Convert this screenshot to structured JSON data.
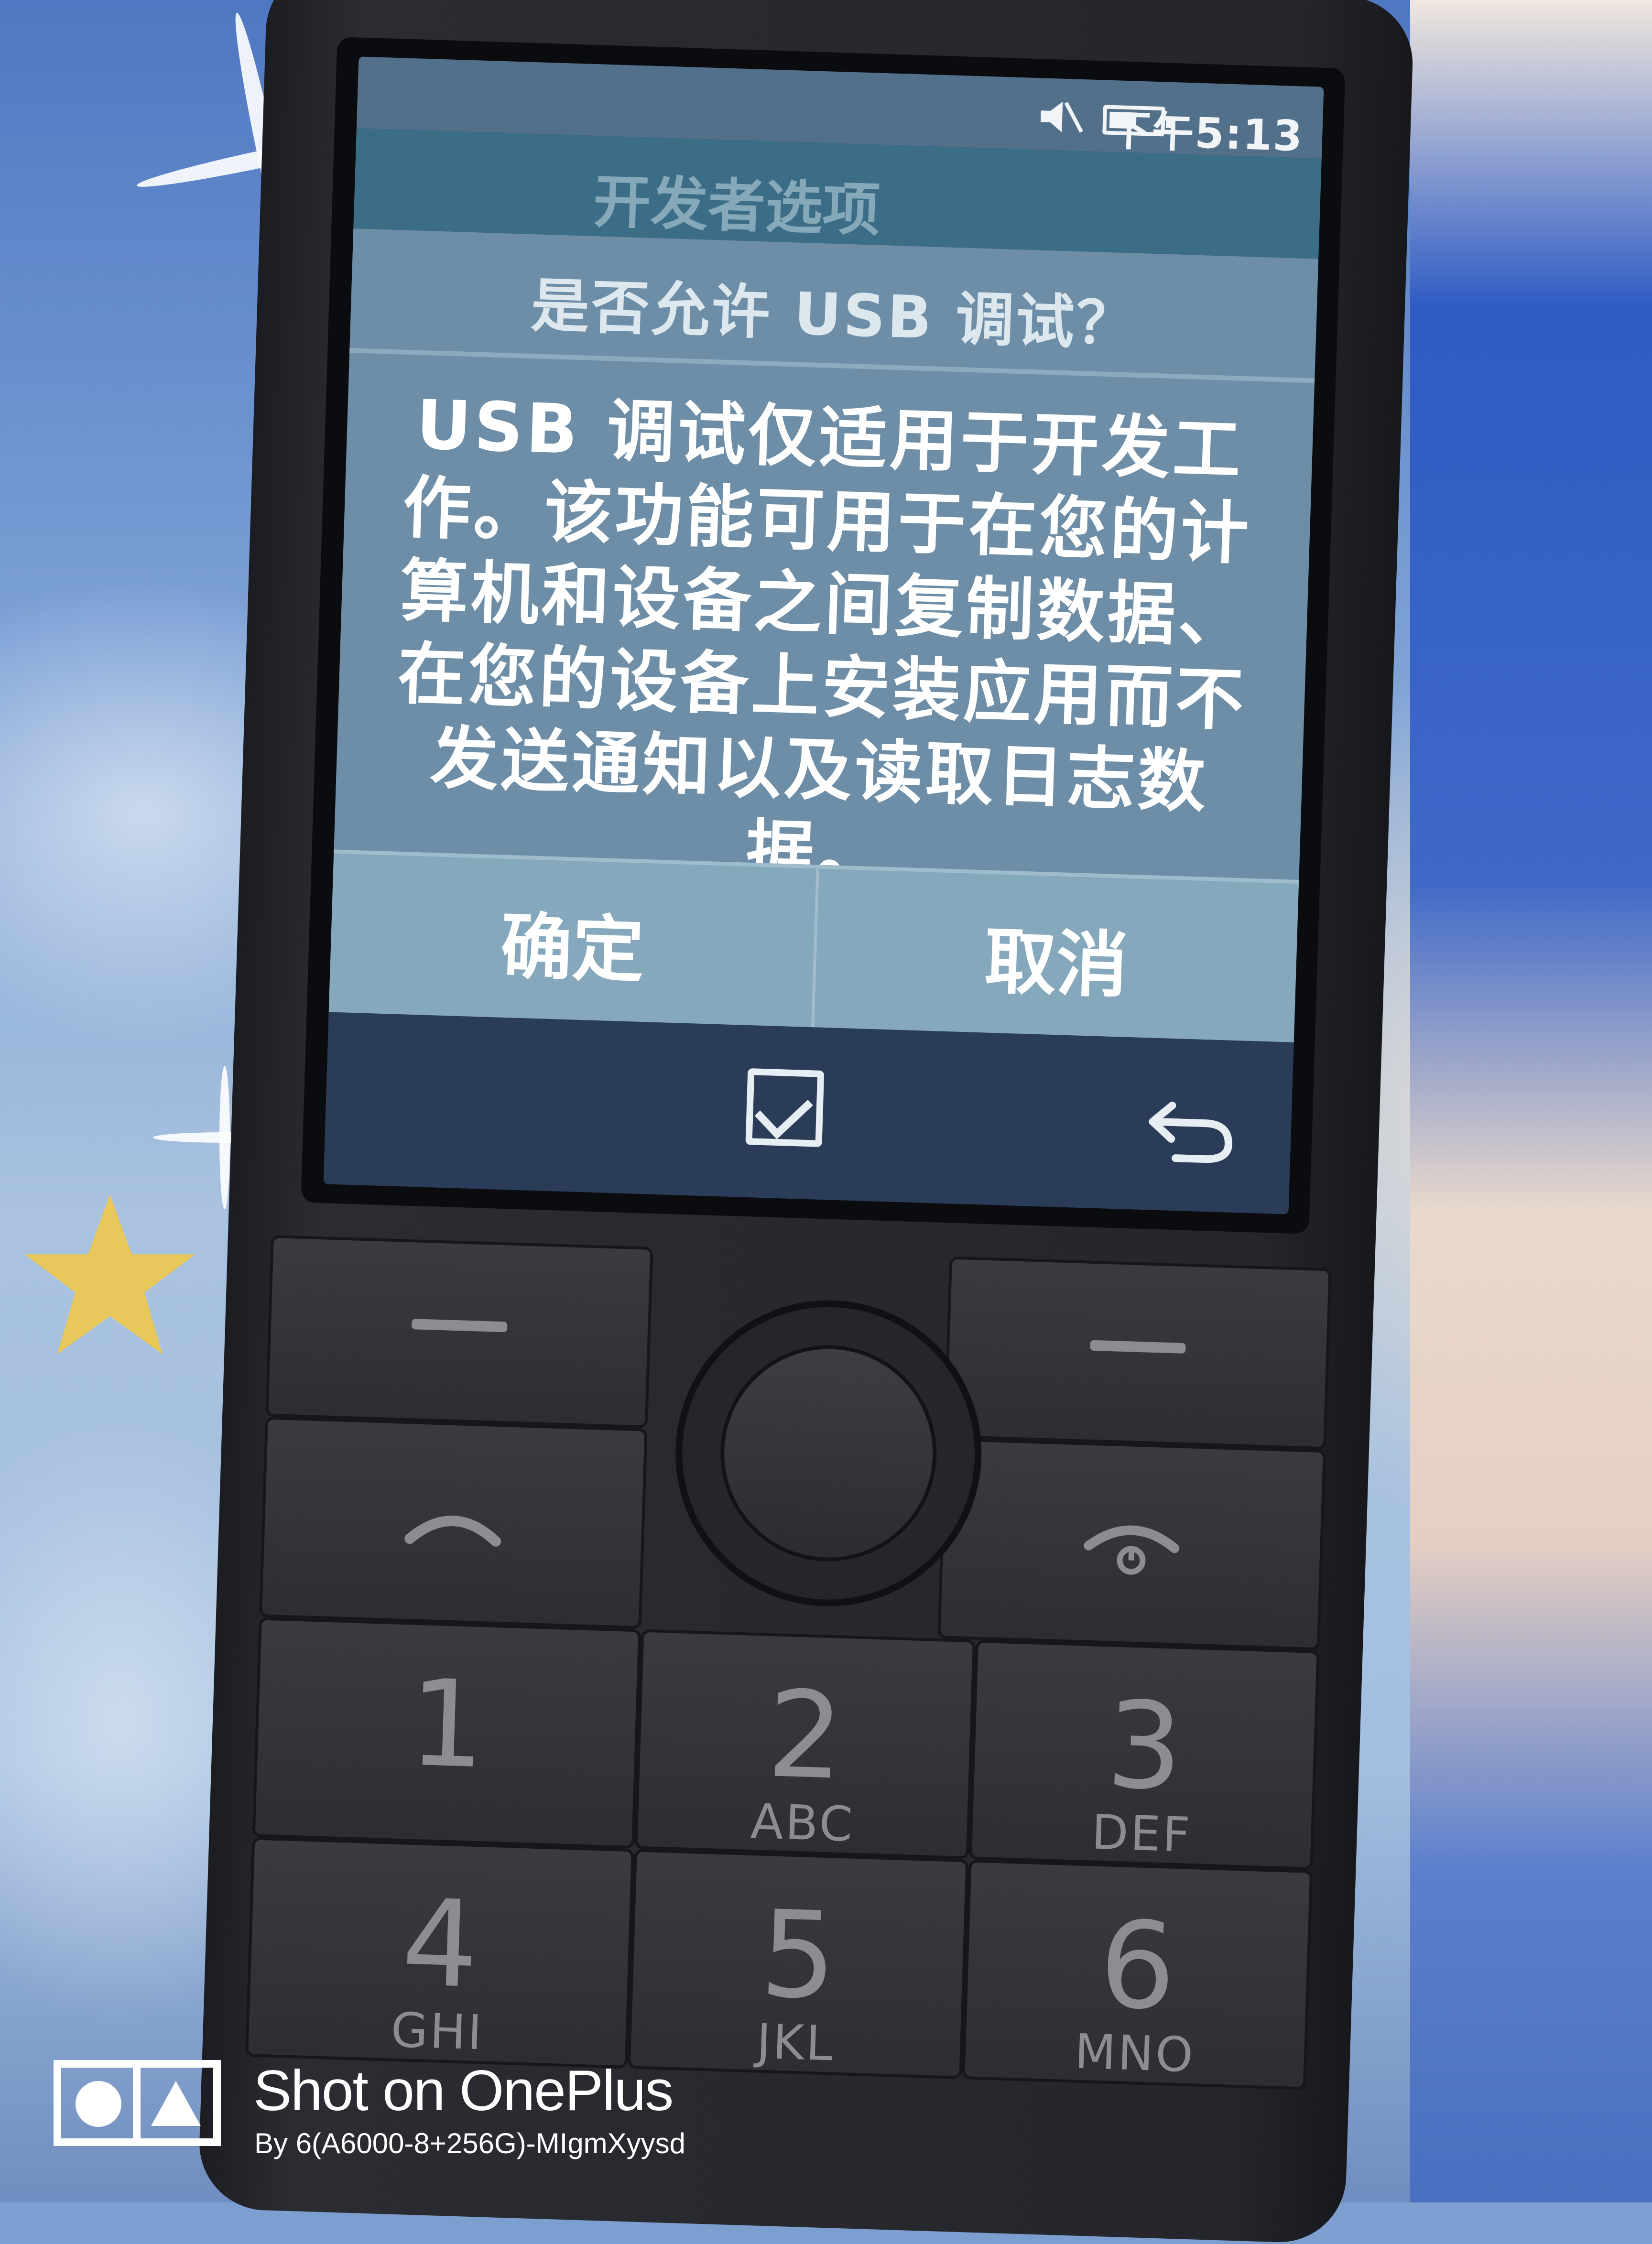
{
  "status_bar": {
    "time": "下午5:13",
    "mute_icon": "speaker-muted-icon",
    "battery_icon": "battery-icon"
  },
  "app": {
    "title": "开发者选项"
  },
  "dialog": {
    "title": "是否允许 USB 调试？",
    "message": "USB 调试仅适用于开发工作。该功能可用于在您的计算机和设备之间复制数据、在您的设备上安装应用而不发送通知以及读取日志数据。",
    "confirm_label": "确定",
    "cancel_label": "取消"
  },
  "softkeys": {
    "center_icon": "checkbox-check-icon",
    "right_icon": "back-arrow-icon"
  },
  "keypad": {
    "keys": [
      {
        "digit": "1",
        "letters": ""
      },
      {
        "digit": "2",
        "letters": "ABC"
      },
      {
        "digit": "3",
        "letters": "DEF"
      },
      {
        "digit": "4",
        "letters": "GHI"
      },
      {
        "digit": "5",
        "letters": "JKL"
      },
      {
        "digit": "6",
        "letters": "MNO"
      }
    ]
  },
  "watermark": {
    "title": "Shot on OnePlus",
    "subtitle": "By 6(A6000-8+256G)-MIgmXyysd"
  },
  "colors": {
    "dialog_bg": "#6d8ea6",
    "dialog_buttons_bg": "#86a8bc",
    "title_bar_bg": "#3c6d86",
    "phone_body": "#25262c"
  }
}
